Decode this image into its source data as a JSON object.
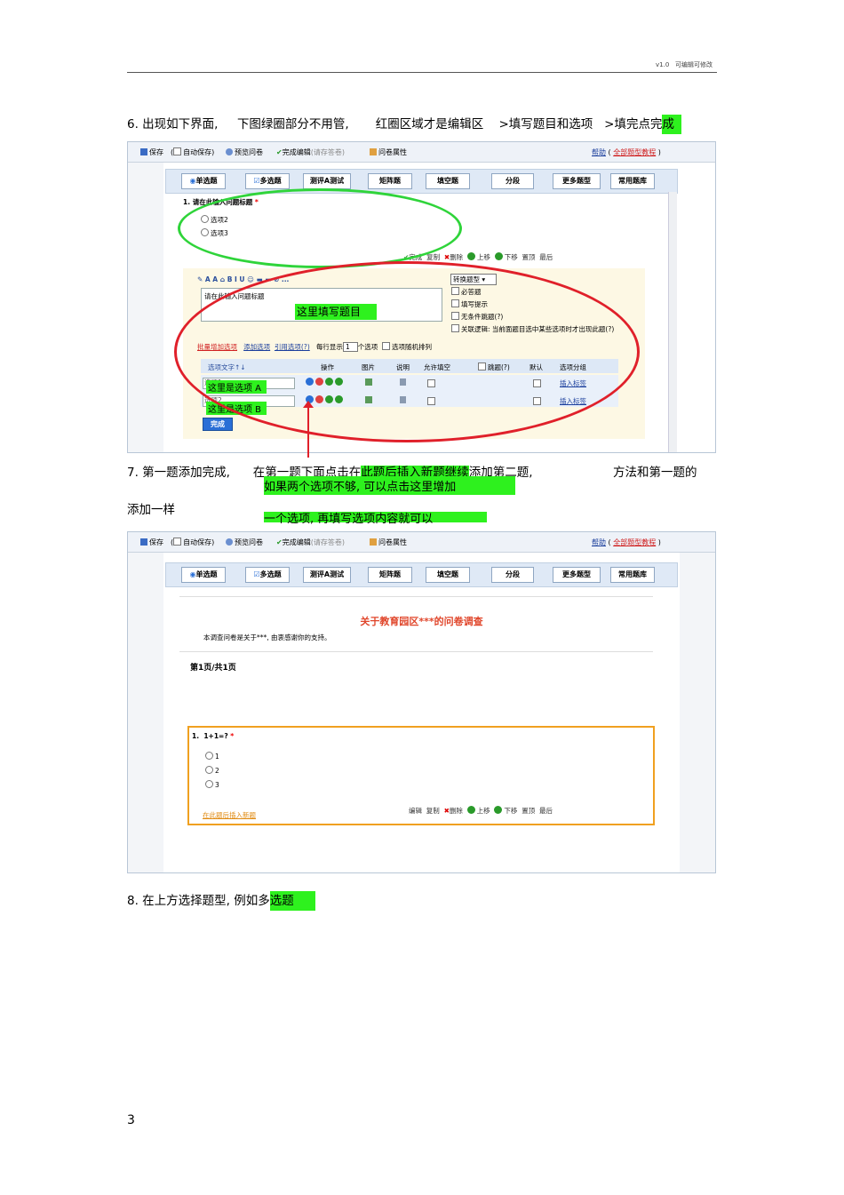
{
  "header": {
    "version": "v1.0",
    "editable": "可编辑可修改"
  },
  "step6": {
    "text_a": "6. 出现如下界面,",
    "text_b": "下图绿圈部分不用管,",
    "text_c": "红圈区域才是编辑区",
    "text_d": ">填写题目和选项",
    "text_e": ">填完点完",
    "text_hl": "成"
  },
  "toolbar": {
    "save": "保存",
    "autosave": "自动保存",
    "preview": "预览问卷",
    "finish_edit": "完成编辑",
    "finish_note": "(请存答卷)",
    "props": "问卷属性",
    "help": "帮助",
    "help_link": "全部题型教程"
  },
  "tabs": [
    "单选题",
    "多选题",
    "测评A测试",
    "矩阵题",
    "填空题",
    "分段",
    "更多题型",
    "常用题库"
  ],
  "editor1": {
    "q_title": "请在此输入问题标题",
    "q_num": "1.",
    "opt1": "选项2",
    "opt2": "选项3",
    "actions": [
      "完成",
      "复制",
      "删除",
      "上移",
      "下移",
      "置顶",
      "最后"
    ],
    "title_input": "请在此输入问题标题",
    "label_title": "这里填写题目",
    "type_select": "转换题型",
    "chk_required": "必答题",
    "chk_hint": "填写提示",
    "chk_cond": "无条件跳题(?)",
    "chk_logic": "关联逻辑: 当前面题目选中某些选项时才出现此题(?)",
    "link_add_opt": "批量增加选项",
    "link_add_col": "添加选项",
    "link_quote": "引用选项(?)",
    "per_row": "每行显示",
    "per_row_val": "1",
    "per_row_unit": "个选项",
    "random": "选项随机排列",
    "col_text": "选项文字↑↓",
    "col_op": "操作",
    "col_img": "图片",
    "col_desc": "说明",
    "col_fill": "允许填空",
    "col_jump": "跳题(?)",
    "col_default": "默认",
    "col_group": "选项分组",
    "row1_val": "选项1",
    "row2_val": "选项2",
    "insert_tag": "插入标签",
    "label_a": "这里是选项 A",
    "label_b": "这里是选项 B",
    "done_btn": "完成"
  },
  "step7": {
    "text_a": "7. 第一题添加完成,",
    "text_b": "在第一题下面点击在",
    "text_hl": "此题后插入新题继续",
    "text_c": "添加第二题,",
    "text_d": "方法和第一题的",
    "note1": "如果两个选项不够, 可以点击这里增加",
    "text_e": "添加一样",
    "note2": "一个选项, 再填写选项内容就可以"
  },
  "preview": {
    "survey_title": "关于教育园区***的问卷调查",
    "survey_desc": "本调查问卷是关于***, 由衷感谢你的支持。",
    "page_info": "第1页/共1页",
    "q_num": "1.",
    "q_text": "1+1=?",
    "options": [
      "1",
      "2",
      "3"
    ],
    "insert_link": "在此题后插入新题",
    "actions": [
      "编辑",
      "复制",
      "删除",
      "上移",
      "下移",
      "置顶",
      "最后"
    ]
  },
  "step8": {
    "text": "8. 在上方选择题型, 例如多",
    "text_hl": "选题"
  },
  "page_number": "3",
  "colors": {
    "highlight": "#2ef11e",
    "green_ring": "#2fd43a",
    "red_ring": "#e0202a",
    "orange_box": "#f0a020"
  }
}
